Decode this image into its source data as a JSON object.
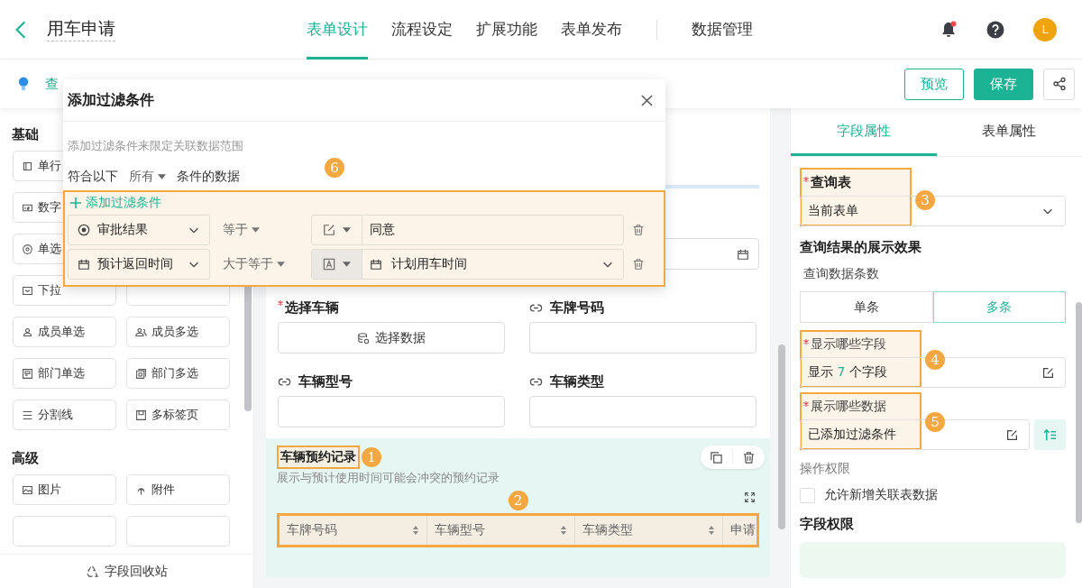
{
  "header": {
    "title": "用车申请",
    "nav": [
      {
        "label": "表单设计",
        "selected": true
      },
      {
        "label": "流程设定",
        "selected": false
      },
      {
        "label": "扩展功能",
        "selected": false
      },
      {
        "label": "表单发布",
        "selected": false
      },
      {
        "label": "数据管理",
        "selected": false
      }
    ],
    "notification": true,
    "avatar": "L"
  },
  "toolbar": {
    "link": "查",
    "buttons": [
      {
        "label": "预览",
        "kind": "outline"
      },
      {
        "label": "保存",
        "kind": "primary"
      }
    ]
  },
  "sidebar": {
    "groups": [
      {
        "title": "基础",
        "rows": [
          [
            {
              "label": "单行",
              "kind": "text"
            }
          ],
          [
            {
              "label": "数字",
              "kind": "number"
            }
          ],
          [
            {
              "label": "单选",
              "kind": "radio"
            }
          ],
          [
            {
              "label": "下拉",
              "kind": "dropdown"
            }
          ],
          [
            {
              "label": "成员单选",
              "kind": "member"
            },
            {
              "label": "成员多选",
              "kind": "members"
            }
          ],
          [
            {
              "label": "部门单选",
              "kind": "dept"
            },
            {
              "label": "部门多选",
              "kind": "depts"
            }
          ],
          [
            {
              "label": "分割线",
              "kind": "divider"
            },
            {
              "label": "多标签页",
              "kind": "tabs"
            }
          ]
        ]
      },
      {
        "title": "高级",
        "rows": [
          [
            {
              "label": "图片",
              "kind": "image"
            },
            {
              "label": "附件",
              "kind": "attachment"
            }
          ],
          []
        ]
      }
    ],
    "footer": "字段回收站"
  },
  "canvas": {
    "fields": [
      {
        "label": "选择车辆",
        "required": true,
        "kind": "data_select",
        "button": "选择数据"
      },
      {
        "label": "车牌号码",
        "required": false,
        "kind": "linked"
      },
      {
        "label": "车辆型号",
        "required": false,
        "kind": "linked"
      },
      {
        "label": "车辆类型",
        "required": false,
        "kind": "linked"
      }
    ],
    "relation": {
      "title": "车辆预约记录",
      "title_badge": "1",
      "description": "展示与预计使用时间可能会冲突的预约记录",
      "table_badge": "2",
      "columns": [
        "车牌号码",
        "车辆型号",
        "车辆类型",
        "申请"
      ]
    }
  },
  "properties": {
    "tabs": [
      {
        "label": "字段属性",
        "selected": true
      },
      {
        "label": "表单属性",
        "selected": false
      }
    ],
    "query_table": {
      "label": "查询表",
      "required": true,
      "value": "当前表单",
      "badge": "3"
    },
    "section": "查询结果的展示效果",
    "count_label": "查询数据条数",
    "count_options": [
      {
        "label": "单条",
        "selected": false
      },
      {
        "label": "多条",
        "selected": true
      }
    ],
    "fields_display": {
      "label": "显示哪些字段",
      "required": true,
      "prefix": "显示",
      "count": "7",
      "suffix": "个字段",
      "badge": "4"
    },
    "data_display": {
      "label": "展示哪些数据",
      "required": true,
      "value": "已添加过滤条件",
      "badge": "5"
    },
    "permission_label": "操作权限",
    "allow_add": {
      "label": "允许新增关联表数据",
      "checked": false
    },
    "field_permission": "字段权限"
  },
  "filter_dialog": {
    "title": "添加过滤条件",
    "hint": "添加过滤条件来限定关联数据范围",
    "match_prefix": "符合以下",
    "match_mode": "所有",
    "match_suffix": "条件的数据",
    "badge": "6",
    "add_label": "添加过滤条件",
    "conditions": [
      {
        "field": {
          "kind": "radio",
          "label": "审批结果"
        },
        "operator": "等于",
        "source": {
          "kind": "custom"
        },
        "value": {
          "kind": "text",
          "label": "同意"
        }
      },
      {
        "field": {
          "kind": "date",
          "label": "预计返回时间"
        },
        "operator": "大于等于",
        "source": {
          "kind": "field"
        },
        "value": {
          "kind": "date",
          "label": "计划用车时间"
        }
      }
    ]
  }
}
